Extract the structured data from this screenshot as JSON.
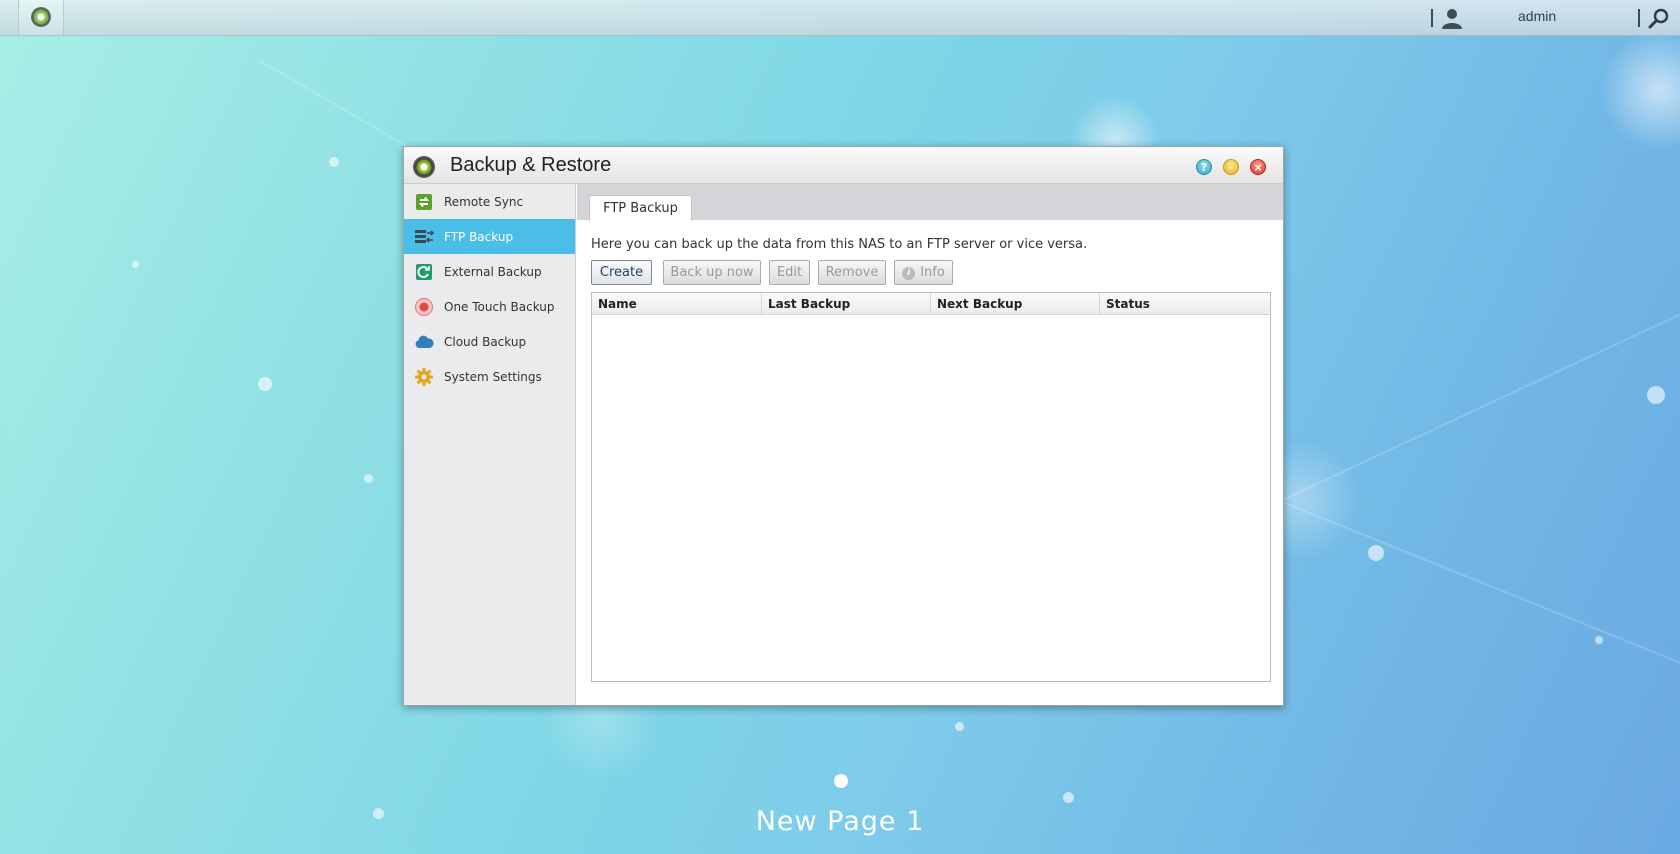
{
  "topbar": {
    "username": "admin"
  },
  "window": {
    "title": "Backup & Restore",
    "help_glyph": "?",
    "min_glyph": "–",
    "close_glyph": "×"
  },
  "sidebar": {
    "items": [
      {
        "label": "Remote Sync",
        "icon": "remote-sync-icon",
        "active": false
      },
      {
        "label": "FTP Backup",
        "icon": "ftp-backup-icon",
        "active": true
      },
      {
        "label": "External Backup",
        "icon": "external-backup-icon",
        "active": false
      },
      {
        "label": "One Touch Backup",
        "icon": "one-touch-backup-icon",
        "active": false
      },
      {
        "label": "Cloud Backup",
        "icon": "cloud-icon",
        "active": false
      },
      {
        "label": "System Settings",
        "icon": "gear-icon",
        "active": false
      }
    ]
  },
  "main": {
    "tab": "FTP Backup",
    "description": "Here you can back up the data from this NAS to an FTP server or vice versa.",
    "buttons": {
      "create": "Create",
      "backup_now": "Back up now",
      "edit": "Edit",
      "remove": "Remove",
      "info": "Info"
    },
    "table": {
      "columns": [
        "Name",
        "Last Backup",
        "Next Backup",
        "Status"
      ],
      "rows": []
    }
  },
  "desktop": {
    "page_label": "New Page 1"
  },
  "colors": {
    "accent": "#4bbde9",
    "help": "#2aa9c9",
    "minimize": "#e7b21b",
    "close": "#d6352a"
  }
}
